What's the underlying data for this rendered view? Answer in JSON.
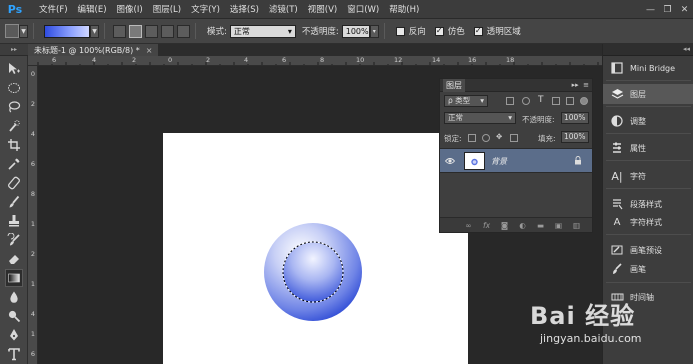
{
  "app": {
    "logo": "Ps",
    "menu": [
      "文件(F)",
      "编辑(E)",
      "图像(I)",
      "图层(L)",
      "文字(Y)",
      "选择(S)",
      "滤镜(T)",
      "视图(V)",
      "窗口(W)",
      "帮助(H)"
    ],
    "window_controls": [
      "minimize",
      "restore",
      "close"
    ]
  },
  "options": {
    "mode_label": "模式:",
    "mode_value": "正常",
    "opacity_label": "不透明度:",
    "opacity_value": "100%",
    "reverse_label": "反向",
    "reverse_checked": false,
    "dither_label": "仿色",
    "dither_checked": true,
    "transparency_label": "透明区域",
    "transparency_checked": true,
    "gradient_colors": [
      "#2f4ce0",
      "#cfd6ff"
    ]
  },
  "document": {
    "tab_title": "未标题-1 @ 100%(RGB/8) *",
    "canvas_color": "#ffffff"
  },
  "rulers": {
    "top": [
      "6",
      "4",
      "2",
      "0",
      "2",
      "4",
      "6",
      "8",
      "10",
      "12",
      "14",
      "16",
      "18"
    ],
    "left": [
      "0",
      "2",
      "4",
      "6",
      "8",
      "1",
      "2",
      "1",
      "4",
      "1",
      "6"
    ]
  },
  "layers_panel": {
    "title": "图层",
    "filter_label": "ρ 类型",
    "blend_mode": "正常",
    "opacity_label": "不透明度:",
    "opacity_value": "100%",
    "lock_label": "锁定:",
    "fill_label": "填充:",
    "fill_value": "100%",
    "layers": [
      {
        "name": "背景",
        "visible": true,
        "locked": true
      }
    ]
  },
  "right_dock": {
    "items": [
      {
        "label": "Mini Bridge",
        "icon": "mini-bridge-icon"
      },
      {
        "label": "图层",
        "icon": "layers-icon",
        "active": true
      },
      {
        "label": "调整",
        "icon": "adjustments-icon"
      },
      {
        "label": "属性",
        "icon": "properties-icon"
      },
      {
        "label": "字符",
        "icon": "character-icon"
      },
      {
        "label": "段落样式",
        "icon": "paragraph-styles-icon"
      },
      {
        "label": "字符样式",
        "icon": "character-styles-icon"
      },
      {
        "label": "画笔预设",
        "icon": "brush-presets-icon"
      },
      {
        "label": "画笔",
        "icon": "brush-icon"
      },
      {
        "label": "时间轴",
        "icon": "timeline-icon"
      }
    ]
  },
  "watermark": {
    "brand": "Bai 经验",
    "url": "jingyan.baidu.com"
  }
}
